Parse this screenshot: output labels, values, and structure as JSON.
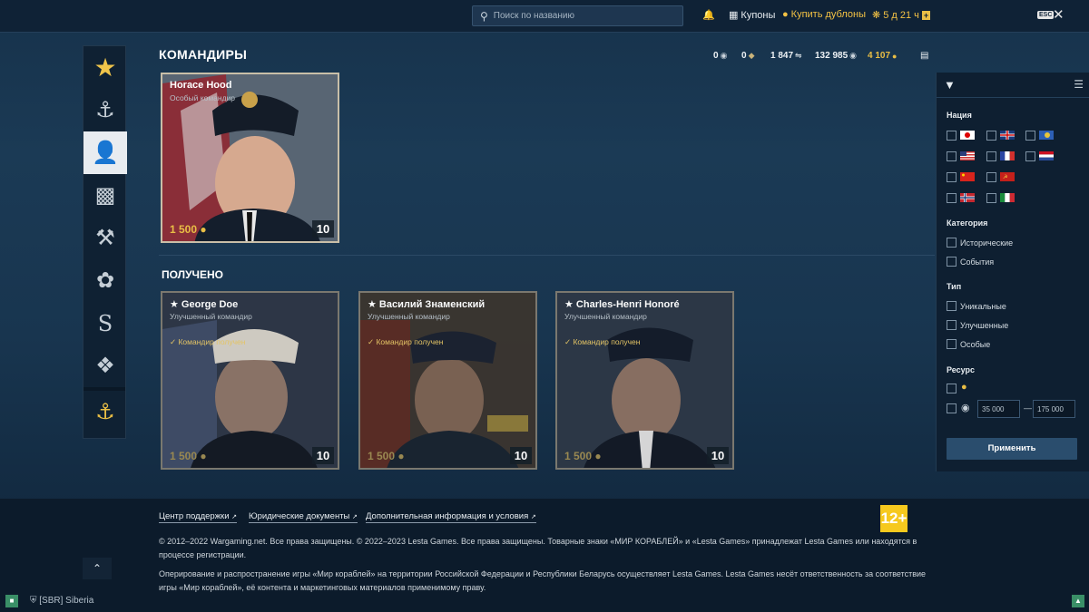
{
  "topbar": {
    "search_placeholder": "Поиск по названию",
    "coupons_label": "Купоны",
    "buy_doubloons_label": "Купить дублоны",
    "premium_time": "5 д 21 ч",
    "esc_label": "ESC"
  },
  "page": {
    "title": "КОМАНДИРЫ",
    "received_title": "ПОЛУЧЕНО"
  },
  "resources": {
    "res1": "0",
    "res2": "0",
    "res3": "1 847",
    "credits": "132 985",
    "doubloons": "4 107"
  },
  "featured_commander": {
    "name": "Horace Hood",
    "subtitle": "Особый командир",
    "price": "1 500",
    "level": "10"
  },
  "received_commanders": [
    {
      "name": "George Doe",
      "subtitle": "Улучшенный командир",
      "status": "Командир получен",
      "price": "1 500",
      "level": "10"
    },
    {
      "name": "Василий Знаменский",
      "subtitle": "Улучшенный командир",
      "status": "Командир получен",
      "price": "1 500",
      "level": "10"
    },
    {
      "name": "Charles-Henri Honoré",
      "subtitle": "Улучшенный командир",
      "status": "Командир получен",
      "price": "1 500",
      "level": "10"
    }
  ],
  "filter": {
    "nation_label": "Нация",
    "category_label": "Категория",
    "category_options": [
      "Исторические",
      "События"
    ],
    "type_label": "Тип",
    "type_options": [
      "Уникальные",
      "Улучшенные",
      "Особые"
    ],
    "resource_label": "Ресурс",
    "range_min": "35 000",
    "range_dash": "—",
    "range_max": "175 000",
    "apply_label": "Применить"
  },
  "footer": {
    "links": [
      "Центр поддержки",
      "Юридические документы",
      "Дополнительная информация и условия"
    ],
    "copyright": "© 2012–2022 Wargaming.net. Все права защищены. © 2022–2023 Lesta Games. Все права защищены. Товарные знаки «МИР КОРАБЛЕЙ» и «Lesta Games» принадлежат Lesta Games или находятся в процессе регистрации.",
    "operation": "Оперирование и распространение игры «Мир кораблей» на территории Российской Федерации и Республики Беларусь осуществляет Lesta Games. Lesta Games несёт ответственность за соответствие игры «Мир кораблей», её контента и маркетинговых материалов применимому праву.",
    "age_rating": "12+"
  },
  "statusbar": {
    "clan": "[SBR] Siberia"
  }
}
